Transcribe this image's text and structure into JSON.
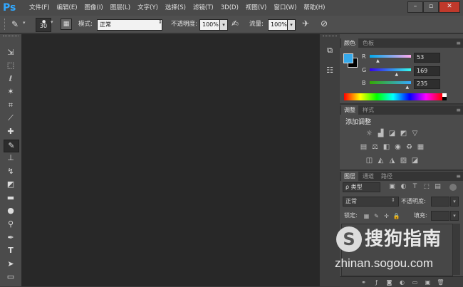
{
  "app": {
    "logo": "Ps"
  },
  "menu": [
    "文件(F)",
    "编辑(E)",
    "图像(I)",
    "图层(L)",
    "文字(Y)",
    "选择(S)",
    "滤镜(T)",
    "3D(D)",
    "视图(V)",
    "窗口(W)",
    "帮助(H)"
  ],
  "options": {
    "brush_size": "30",
    "mode_label": "模式:",
    "mode_value": "正常",
    "opacity_label": "不透明度:",
    "opacity_value": "100%",
    "flow_label": "流量:",
    "flow_value": "100%"
  },
  "color_panel": {
    "tabs": [
      "颜色",
      "色板"
    ],
    "channels": [
      {
        "label": "R",
        "value": "53",
        "fraction": 0.208
      },
      {
        "label": "G",
        "value": "169",
        "fraction": 0.663
      },
      {
        "label": "B",
        "value": "235",
        "fraction": 0.922
      }
    ],
    "foreground": "#35a9eb",
    "background": "#000000"
  },
  "adjust_panel": {
    "tabs": [
      "调整",
      "样式"
    ],
    "heading": "添加调整"
  },
  "layers_panel": {
    "tabs": [
      "图层",
      "通道",
      "路径"
    ],
    "filter_label": "ρ 类型",
    "blend_value": "正常",
    "opacity_label": "不透明度:",
    "lock_label": "锁定:",
    "fill_label": "填充:"
  },
  "watermark": {
    "brand": "搜狗指南",
    "url": "zhinan.sogou.com"
  }
}
